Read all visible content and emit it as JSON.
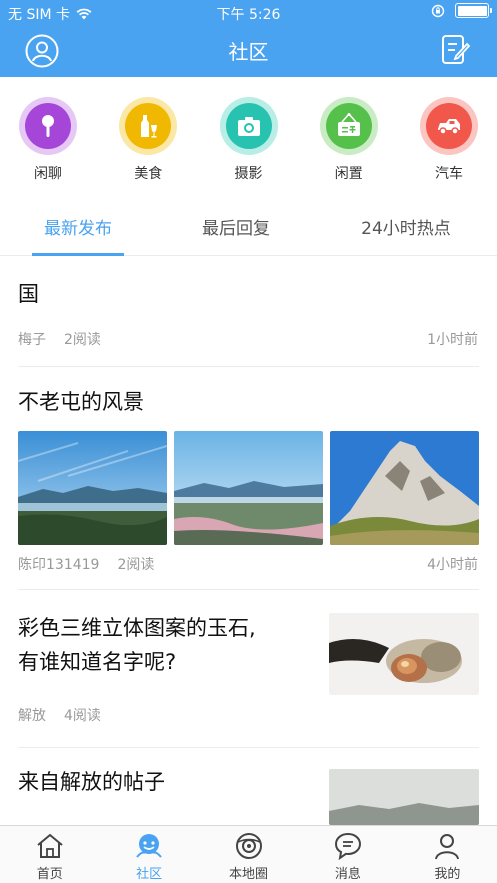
{
  "status": {
    "carrier": "无 SIM 卡",
    "time": "下午 5:26"
  },
  "header": {
    "title": "社区"
  },
  "categories": [
    {
      "label": "闲聊",
      "icon": "microphone-icon",
      "color": "#a646d8"
    },
    {
      "label": "美食",
      "icon": "bottle-glass-icon",
      "color": "#f0b800"
    },
    {
      "label": "摄影",
      "icon": "camera-icon",
      "color": "#28c2b0"
    },
    {
      "label": "闲置",
      "icon": "secondhand-sign-icon",
      "color": "#55c14a"
    },
    {
      "label": "汽车",
      "icon": "car-icon",
      "color": "#f2574b"
    }
  ],
  "tabs": [
    {
      "label": "最新发布"
    },
    {
      "label": "最后回复"
    },
    {
      "label": "24小时热点"
    }
  ],
  "posts": [
    {
      "title": "国",
      "author": "梅子",
      "reads": "2阅读",
      "time": "1小时前"
    },
    {
      "title": "不老屯的风景",
      "author": "陈印131419",
      "reads": "2阅读",
      "time": "4小时前"
    },
    {
      "title_line1": "彩色三维立体图案的玉石,",
      "title_line2": "有谁知道名字呢?",
      "author": "解放",
      "reads": "4阅读"
    },
    {
      "title": "来自解放的帖子"
    }
  ],
  "bottom_tabs": [
    {
      "label": "首页",
      "icon": "home-icon"
    },
    {
      "label": "社区",
      "icon": "community-icon"
    },
    {
      "label": "本地圈",
      "icon": "local-circle-icon"
    },
    {
      "label": "消息",
      "icon": "message-icon"
    },
    {
      "label": "我的",
      "icon": "profile-icon"
    }
  ]
}
